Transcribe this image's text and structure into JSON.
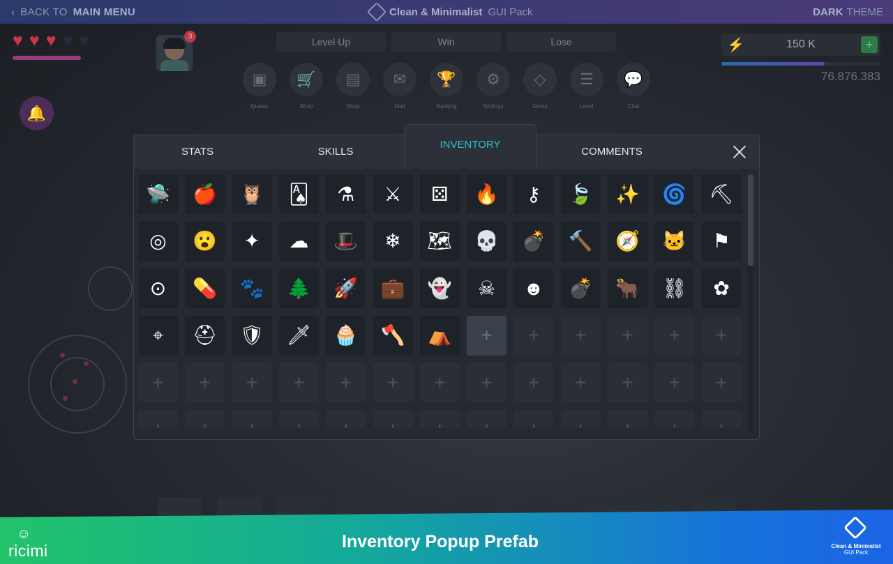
{
  "topbar": {
    "back_prefix": "BACK TO",
    "back_bold": "MAIN MENU",
    "title_bold": "Clean & Minimalist",
    "title_rest": "GUI Pack",
    "theme_bold": "DARK",
    "theme_rest": "THEME"
  },
  "hud": {
    "hearts_total": 5,
    "hearts_filled": 3,
    "heart_colors": {
      "filled": "#c8384b",
      "empty": "#1f2d3d"
    },
    "hp_progress": 0.65,
    "notification_count": "3",
    "buttons": [
      "Level Up",
      "Win",
      "Lose"
    ],
    "nav": [
      {
        "label": "Quests",
        "icon": "quests-icon",
        "glyph": "▣"
      },
      {
        "label": "Shop",
        "icon": "cart-icon",
        "glyph": "🛒"
      },
      {
        "label": "Shop",
        "icon": "shop-icon",
        "glyph": "▤"
      },
      {
        "label": "Mail",
        "icon": "mail-icon",
        "glyph": "✉"
      },
      {
        "label": "Ranking",
        "icon": "trophy-icon",
        "glyph": "🏆"
      },
      {
        "label": "Settings",
        "icon": "gear-icon",
        "glyph": "⚙"
      },
      {
        "label": "Gems",
        "icon": "gem-icon",
        "glyph": "◇"
      },
      {
        "label": "Level",
        "icon": "list-icon",
        "glyph": "☰"
      },
      {
        "label": "Chat",
        "icon": "chat-icon",
        "glyph": "💬"
      }
    ],
    "energy_value": "150 K",
    "energy_progress": 0.65,
    "score": "76.876.383"
  },
  "popup": {
    "tabs": [
      "STATS",
      "SKILLS",
      "INVENTORY",
      "COMMENTS"
    ],
    "active_tab": "INVENTORY",
    "accent_color": "#2fc1cc",
    "items": [
      {
        "icon": "ufo-icon",
        "glyph": "🛸"
      },
      {
        "icon": "apple-icon",
        "glyph": "🍎"
      },
      {
        "icon": "owl-icon",
        "glyph": "🦉"
      },
      {
        "icon": "cards-icon",
        "glyph": "🂡"
      },
      {
        "icon": "cauldron-icon",
        "glyph": "⚗"
      },
      {
        "icon": "scythe-icon",
        "glyph": "⚔"
      },
      {
        "icon": "dice-icon",
        "glyph": "⚄"
      },
      {
        "icon": "fire-icon",
        "glyph": "🔥"
      },
      {
        "icon": "key-icon",
        "glyph": "⚷"
      },
      {
        "icon": "leaf-icon",
        "glyph": "🍃"
      },
      {
        "icon": "magic-wand-icon",
        "glyph": "✨"
      },
      {
        "icon": "swirl-icon",
        "glyph": "🌀"
      },
      {
        "icon": "pickaxe-icon",
        "glyph": "⛏"
      },
      {
        "icon": "spiral-icon",
        "glyph": "◎"
      },
      {
        "icon": "surprised-face-icon",
        "glyph": "😮"
      },
      {
        "icon": "magic-staff-icon",
        "glyph": "✦"
      },
      {
        "icon": "creature-icon",
        "glyph": "☁"
      },
      {
        "icon": "witch-hat-icon",
        "glyph": "🎩"
      },
      {
        "icon": "snowflake-icon",
        "glyph": "❄"
      },
      {
        "icon": "treasure-map-icon",
        "glyph": "🗺"
      },
      {
        "icon": "skull-icon",
        "glyph": "💀"
      },
      {
        "icon": "cannon-icon",
        "glyph": "💣"
      },
      {
        "icon": "hammer-icon",
        "glyph": "🔨"
      },
      {
        "icon": "compass-icon",
        "glyph": "🧭"
      },
      {
        "icon": "cat-icon",
        "glyph": "🐱"
      },
      {
        "icon": "flag-icon",
        "glyph": "⚑"
      },
      {
        "icon": "orbit-icon",
        "glyph": "⊙"
      },
      {
        "icon": "pills-icon",
        "glyph": "💊"
      },
      {
        "icon": "paw-icon",
        "glyph": "🐾"
      },
      {
        "icon": "tree-icon",
        "glyph": "🌲"
      },
      {
        "icon": "rocket-icon",
        "glyph": "🚀"
      },
      {
        "icon": "suitcase-icon",
        "glyph": "💼"
      },
      {
        "icon": "ghost-icon",
        "glyph": "👻"
      },
      {
        "icon": "poison-bottle-icon",
        "glyph": "☠"
      },
      {
        "icon": "zombie-face-icon",
        "glyph": "☻"
      },
      {
        "icon": "bomb-icon",
        "glyph": "💣"
      },
      {
        "icon": "bull-skull-icon",
        "glyph": "🐂"
      },
      {
        "icon": "handcuffs-icon",
        "glyph": "⛓"
      },
      {
        "icon": "flower-icon",
        "glyph": "✿"
      },
      {
        "icon": "target-icon",
        "glyph": "⌖"
      },
      {
        "icon": "knight-helmet-icon",
        "glyph": "⛑"
      },
      {
        "icon": "shield-icon",
        "glyph": "🛡"
      },
      {
        "icon": "sword-icon",
        "glyph": "🗡"
      },
      {
        "icon": "cupcake-icon",
        "glyph": "🧁"
      },
      {
        "icon": "axe-icon",
        "glyph": "🪓"
      },
      {
        "icon": "viking-helmet-icon",
        "glyph": "⛺"
      }
    ],
    "total_slots": 78,
    "columns": 13,
    "empty_glyph": "+",
    "scroll_progress": 0.0
  },
  "footer": {
    "brand": "ricimi",
    "title": "Inventory Popup Prefab",
    "product_name": "Clean & Minimalist",
    "product_sub": "GUI Pack"
  }
}
